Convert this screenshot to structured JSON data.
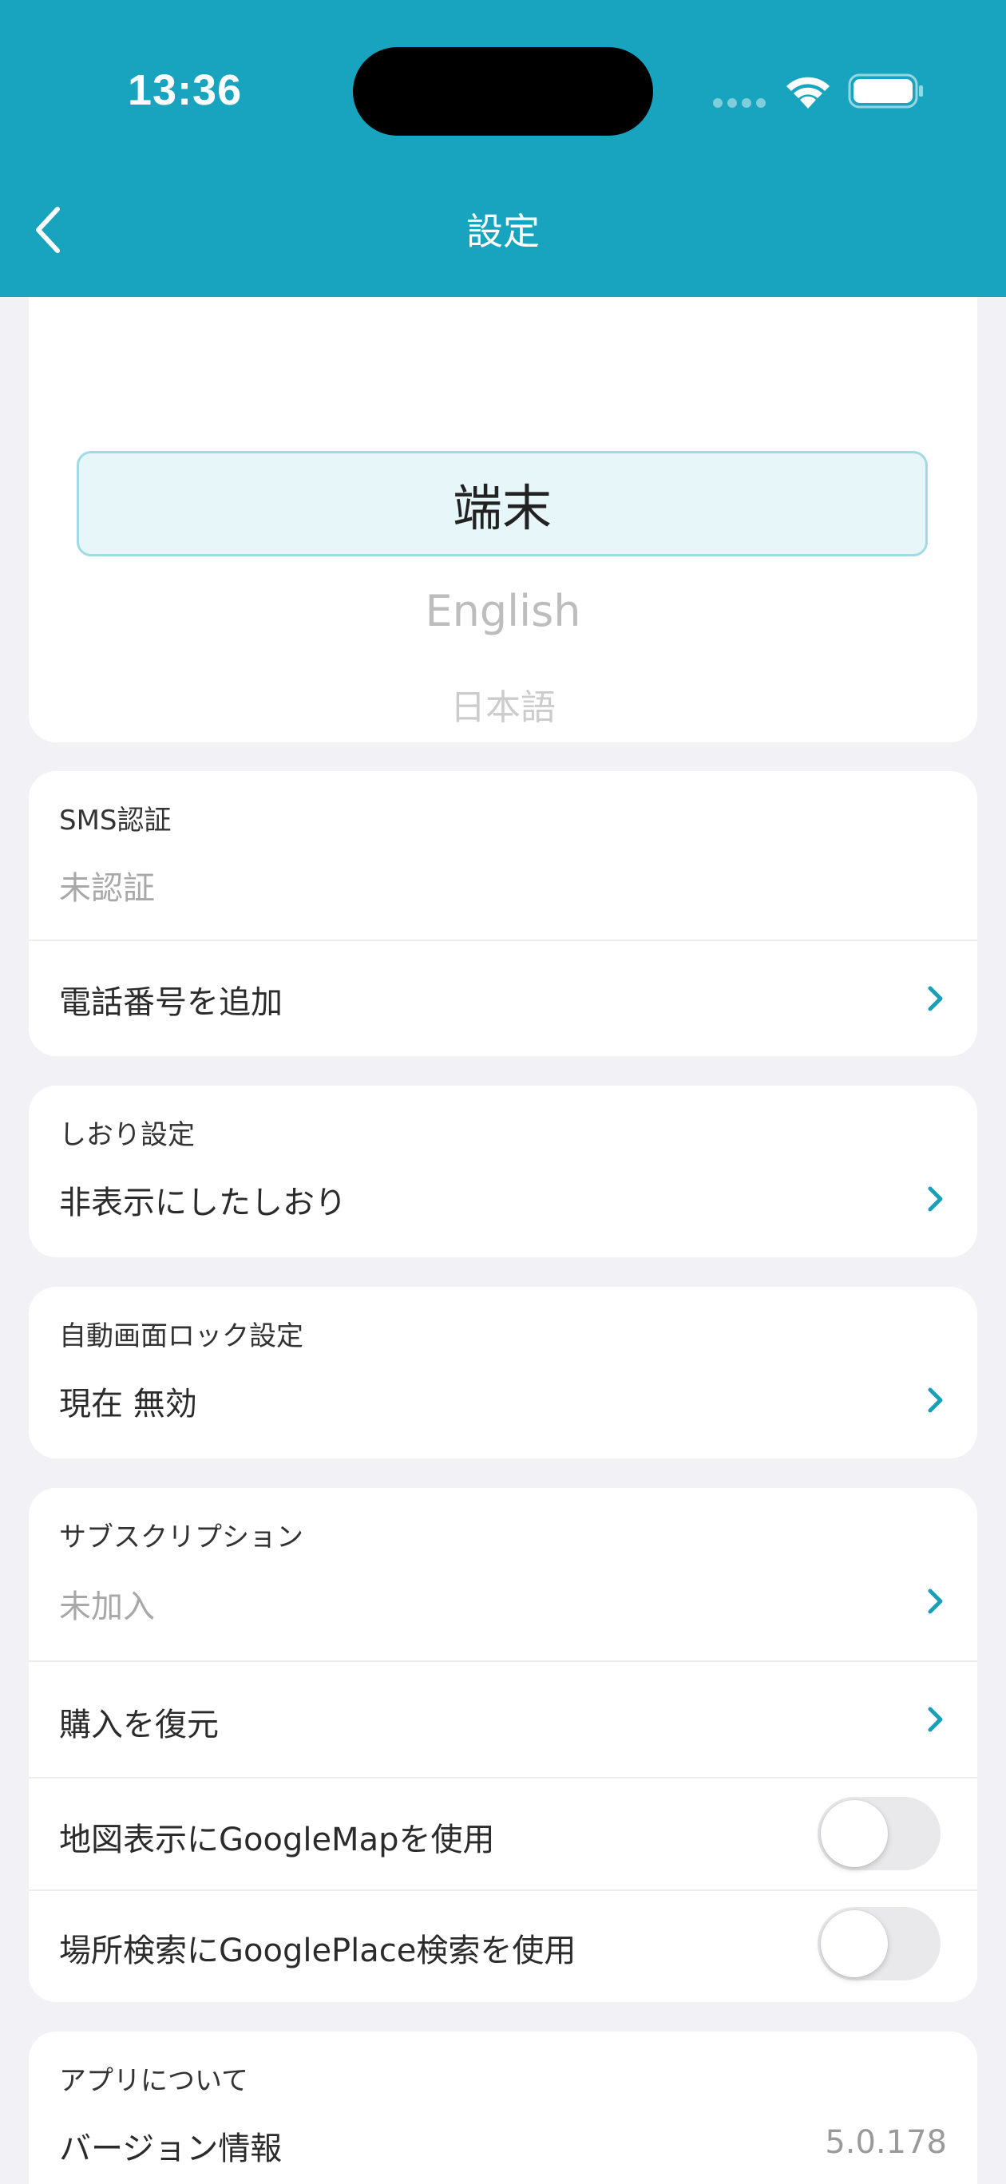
{
  "status_bar": {
    "time": "13:36"
  },
  "nav": {
    "title": "設定"
  },
  "language_picker": {
    "selected": "端末",
    "options": [
      "English",
      "日本語"
    ]
  },
  "sms": {
    "label": "SMS認証",
    "status": "未認証",
    "add_phone": "電話番号を追加"
  },
  "bookmark": {
    "label": "しおり設定",
    "hidden": "非表示にしたしおり"
  },
  "autolock": {
    "label": "自動画面ロック設定",
    "current": "現在 無効"
  },
  "subscription": {
    "label": "サブスクリプション",
    "status": "未加入",
    "restore": "購入を復元",
    "use_google_map": "地図表示にGoogleMapを使用",
    "use_google_map_on": false,
    "use_google_place": "場所検索にGooglePlace検索を使用",
    "use_google_place_on": false
  },
  "about": {
    "label": "アプリについて",
    "version_label": "バージョン情報",
    "version_value": "5.0.178"
  },
  "colors": {
    "header": "#18a4bf",
    "accent": "#1a9fb8",
    "background": "#f2f2f6"
  }
}
